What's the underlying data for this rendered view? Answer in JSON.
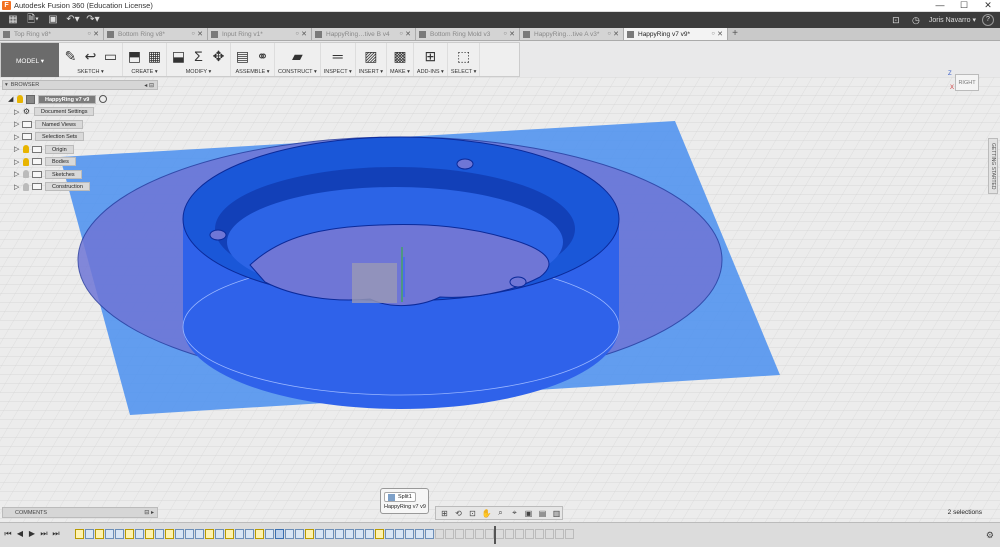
{
  "window": {
    "title": "Autodesk Fusion 360 (Education License)",
    "app_icon": "F",
    "controls": [
      "—",
      "☐",
      "✕"
    ]
  },
  "qab": {
    "grid_icon": "grid-icon",
    "user_name": "Joris Navarro",
    "user_caret": "▾",
    "help_icon": "?"
  },
  "tabs": [
    {
      "label": "Top Ring v8*",
      "active": false
    },
    {
      "label": "Bottom Ring v8*",
      "active": false
    },
    {
      "label": "Input Ring v1*",
      "active": false
    },
    {
      "label": "HappyRing…tive B v4",
      "active": false
    },
    {
      "label": "Bottom Ring Mold v3",
      "active": false
    },
    {
      "label": "HappyRing…tive A v3*",
      "active": false
    },
    {
      "label": "HappyRing v7 v9*",
      "active": true
    }
  ],
  "toolbar": {
    "model_label": "MODEL ▾",
    "groups": [
      {
        "label": "SKETCH ▾",
        "icons": [
          "sketch-icon",
          "arc-icon",
          "rectangle-icon"
        ]
      },
      {
        "label": "CREATE ▾",
        "icons": [
          "extrude-icon",
          "form-icon"
        ]
      },
      {
        "label": "MODIFY ▾",
        "icons": [
          "press-pull-icon",
          "sum-icon",
          "move-icon"
        ]
      },
      {
        "label": "ASSEMBLE ▾",
        "icons": [
          "new-component-icon",
          "joint-icon"
        ]
      },
      {
        "label": "CONSTRUCT ▾",
        "icons": [
          "plane-icon"
        ]
      },
      {
        "label": "INSPECT ▾",
        "icons": [
          "measure-icon"
        ]
      },
      {
        "label": "INSERT ▾",
        "icons": [
          "insert-image-icon"
        ]
      },
      {
        "label": "MAKE ▾",
        "icons": [
          "make-icon"
        ]
      },
      {
        "label": "ADD-INS ▾",
        "icons": [
          "addins-icon"
        ]
      },
      {
        "label": "SELECT ▾",
        "icons": [
          "select-icon"
        ]
      }
    ]
  },
  "browser": {
    "header": "BROWSER",
    "header_btns": "◂ ⊟",
    "root": "HappyRing v7 v9",
    "items": [
      {
        "label": "Document Settings",
        "kind": "gear"
      },
      {
        "label": "Named Views",
        "kind": "folder"
      },
      {
        "label": "Selection Sets",
        "kind": "folder"
      },
      {
        "label": "Origin",
        "kind": "bulb-folder",
        "bulb": "on"
      },
      {
        "label": "Bodies",
        "kind": "bulb-folder",
        "bulb": "on"
      },
      {
        "label": "Sketches",
        "kind": "bulb-folder",
        "bulb": "off"
      },
      {
        "label": "Construction",
        "kind": "bulb-folder",
        "bulb": "off"
      }
    ]
  },
  "viewcube": {
    "face": "RIGHT",
    "axis_z": "Z",
    "axis_x": "X"
  },
  "side_panel": {
    "label": "GETTING STARTED"
  },
  "comments": {
    "label": "COMMENTS",
    "btns": "⊟ ▸"
  },
  "tooltip": {
    "item": "Split1",
    "doc": "HappyRing v7 v9"
  },
  "navbar": {
    "icons": [
      "display-icon",
      "orbit-icon",
      "pan-icon",
      "look-at-icon",
      "zoom-icon",
      "fit-icon",
      "visual-style-icon",
      "grid-settings-icon",
      "viewports-icon"
    ]
  },
  "status": {
    "selections": "2 selections"
  },
  "timeline": {
    "controls": [
      "⏮",
      "◀",
      "▶",
      "⏭",
      "⏭"
    ],
    "items": [
      "sketch",
      "feat",
      "sketch",
      "feat",
      "feat",
      "sketch",
      "feat",
      "sketch",
      "feat",
      "sketch",
      "feat",
      "feat",
      "feat",
      "sketch",
      "feat",
      "sketch",
      "feat",
      "feat",
      "sketch",
      "feat",
      "cur",
      "feat",
      "feat",
      "sketch",
      "feat",
      "feat",
      "feat",
      "feat",
      "feat",
      "feat",
      "sketch",
      "feat",
      "feat",
      "feat",
      "feat",
      "feat",
      "ghost",
      "ghost",
      "ghost",
      "ghost",
      "ghost",
      "ghost",
      "ghost",
      "ghost",
      "ghost",
      "ghost",
      "ghost",
      "ghost",
      "ghost",
      "ghost"
    ],
    "settings_icon": "⚙"
  },
  "colors": {
    "body_blue": "#1a57d8",
    "plane_blue": "#4a8ff0",
    "accent": "#f37021"
  }
}
